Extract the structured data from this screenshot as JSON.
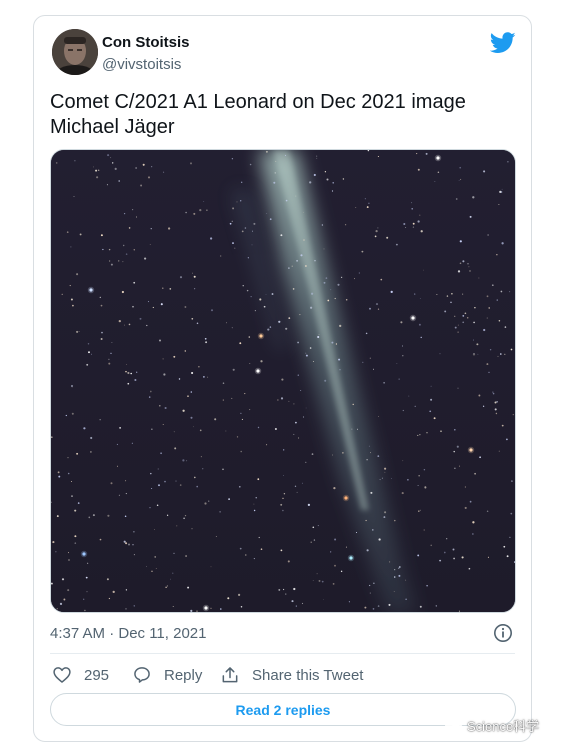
{
  "tweet": {
    "author_name": "Con Stoitsis",
    "author_handle": "@vivstoitsis",
    "text": "Comet C/2021 A1 Leonard on Dec 2021 image Michael Jäger",
    "timestamp": "4:37 AM · Dec 11, 2021"
  },
  "actions": {
    "like_count": "295",
    "reply_label": "Reply",
    "share_label": "Share this Tweet"
  },
  "read_replies_label": "Read 2 replies",
  "watermark": "Science科学",
  "colors": {
    "twitter_blue": "#1d9bf0",
    "text_primary": "#0f1419",
    "text_secondary": "#536471",
    "sky": "#221f30"
  },
  "icons": {
    "logo": "twitter-bird-icon",
    "info": "info-icon",
    "like": "heart-icon",
    "reply": "comment-icon",
    "share": "share-icon"
  }
}
